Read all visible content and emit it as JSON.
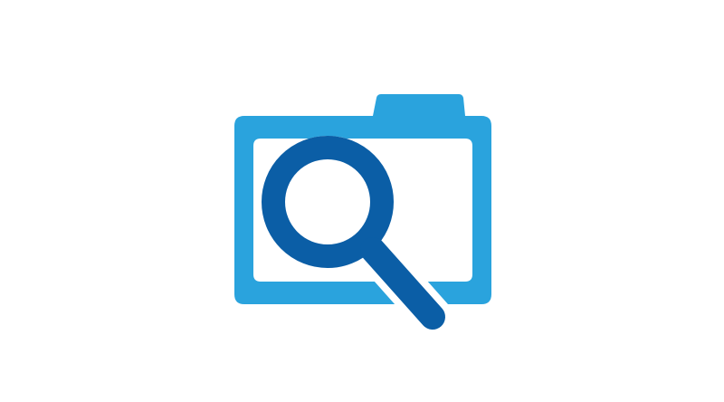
{
  "logo": {
    "icon_name": "camera-search-icon",
    "colors": {
      "background": "#ffffff",
      "camera": "#2aa3dd",
      "magnifier": "#0b5ea6"
    }
  }
}
